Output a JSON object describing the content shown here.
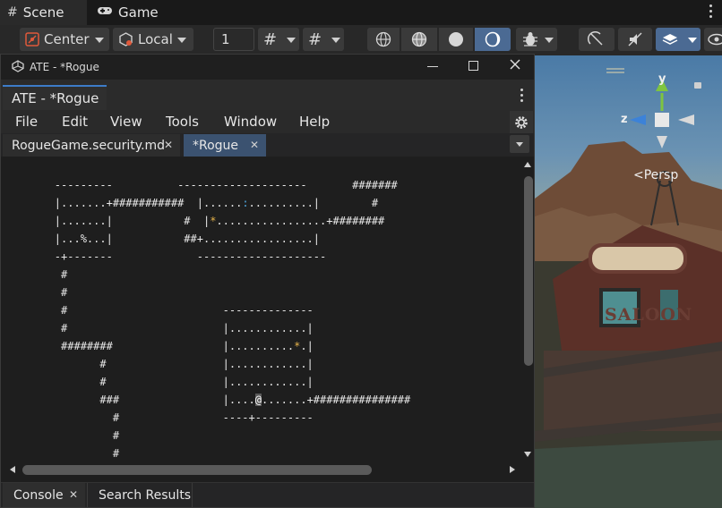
{
  "unity": {
    "tabs": [
      {
        "label": "Scene",
        "icon": "hash-icon"
      },
      {
        "label": "Game",
        "icon": "gamepad-icon"
      }
    ],
    "toolbar": {
      "pivot_label": "Center",
      "space_label": "Local",
      "grid_size_value": "1"
    },
    "scene": {
      "view_label": "Persp",
      "axis_x": "x",
      "axis_y": "y",
      "axis_z": "z",
      "sign_text": "SALOON"
    }
  },
  "ate": {
    "window_title": "ATE - *Rogue",
    "tab_label": "ATE - *Rogue",
    "menu": [
      "File",
      "Edit",
      "View",
      "Tools",
      "Window",
      "Help"
    ],
    "files": [
      {
        "label": "RogueGame.security.md",
        "active": false
      },
      {
        "label": "*Rogue",
        "active": true
      }
    ],
    "map_lines": [
      "        ---------          --------------------       #######",
      "        |.......+###########  |......:..........|        #",
      "        |.......|           #  |*.................+########",
      "        |...%...|           ##+.................|",
      "        -+-------             --------------------",
      "         #",
      "         #",
      "         #                        --------------",
      "         #                        |............|",
      "         ########                 |..........*.|",
      "               #                  |............|",
      "               #                  |............|",
      "               ###                |....@.......+###############",
      "                 #                ----+---------",
      "                 #",
      "                 #"
    ],
    "bottom_tabs": [
      {
        "label": "Console",
        "closable": true
      },
      {
        "label": "Search Results",
        "closable": false
      }
    ],
    "colors": {
      "tab_accent": "#3d7cc9",
      "active_file_tab": "#3b5270",
      "gold_item": "#e6b34a",
      "blue_item": "#4fa8e0"
    }
  }
}
